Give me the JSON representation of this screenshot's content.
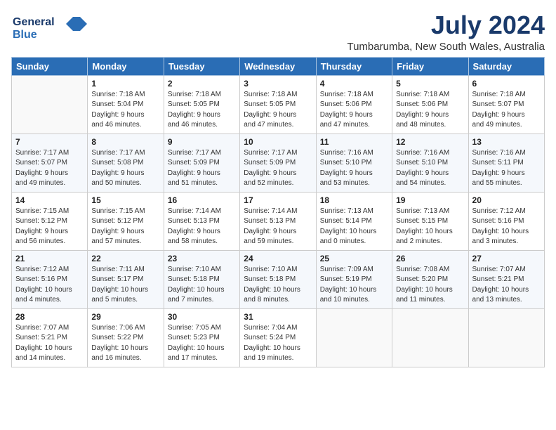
{
  "logo": {
    "line1": "General",
    "line2": "Blue"
  },
  "title": "July 2024",
  "location": "Tumbarumba, New South Wales, Australia",
  "days_of_week": [
    "Sunday",
    "Monday",
    "Tuesday",
    "Wednesday",
    "Thursday",
    "Friday",
    "Saturday"
  ],
  "weeks": [
    [
      {
        "day": "",
        "info": ""
      },
      {
        "day": "1",
        "info": "Sunrise: 7:18 AM\nSunset: 5:04 PM\nDaylight: 9 hours\nand 46 minutes."
      },
      {
        "day": "2",
        "info": "Sunrise: 7:18 AM\nSunset: 5:05 PM\nDaylight: 9 hours\nand 46 minutes."
      },
      {
        "day": "3",
        "info": "Sunrise: 7:18 AM\nSunset: 5:05 PM\nDaylight: 9 hours\nand 47 minutes."
      },
      {
        "day": "4",
        "info": "Sunrise: 7:18 AM\nSunset: 5:06 PM\nDaylight: 9 hours\nand 47 minutes."
      },
      {
        "day": "5",
        "info": "Sunrise: 7:18 AM\nSunset: 5:06 PM\nDaylight: 9 hours\nand 48 minutes."
      },
      {
        "day": "6",
        "info": "Sunrise: 7:18 AM\nSunset: 5:07 PM\nDaylight: 9 hours\nand 49 minutes."
      }
    ],
    [
      {
        "day": "7",
        "info": "Sunrise: 7:17 AM\nSunset: 5:07 PM\nDaylight: 9 hours\nand 49 minutes."
      },
      {
        "day": "8",
        "info": "Sunrise: 7:17 AM\nSunset: 5:08 PM\nDaylight: 9 hours\nand 50 minutes."
      },
      {
        "day": "9",
        "info": "Sunrise: 7:17 AM\nSunset: 5:09 PM\nDaylight: 9 hours\nand 51 minutes."
      },
      {
        "day": "10",
        "info": "Sunrise: 7:17 AM\nSunset: 5:09 PM\nDaylight: 9 hours\nand 52 minutes."
      },
      {
        "day": "11",
        "info": "Sunrise: 7:16 AM\nSunset: 5:10 PM\nDaylight: 9 hours\nand 53 minutes."
      },
      {
        "day": "12",
        "info": "Sunrise: 7:16 AM\nSunset: 5:10 PM\nDaylight: 9 hours\nand 54 minutes."
      },
      {
        "day": "13",
        "info": "Sunrise: 7:16 AM\nSunset: 5:11 PM\nDaylight: 9 hours\nand 55 minutes."
      }
    ],
    [
      {
        "day": "14",
        "info": "Sunrise: 7:15 AM\nSunset: 5:12 PM\nDaylight: 9 hours\nand 56 minutes."
      },
      {
        "day": "15",
        "info": "Sunrise: 7:15 AM\nSunset: 5:12 PM\nDaylight: 9 hours\nand 57 minutes."
      },
      {
        "day": "16",
        "info": "Sunrise: 7:14 AM\nSunset: 5:13 PM\nDaylight: 9 hours\nand 58 minutes."
      },
      {
        "day": "17",
        "info": "Sunrise: 7:14 AM\nSunset: 5:13 PM\nDaylight: 9 hours\nand 59 minutes."
      },
      {
        "day": "18",
        "info": "Sunrise: 7:13 AM\nSunset: 5:14 PM\nDaylight: 10 hours\nand 0 minutes."
      },
      {
        "day": "19",
        "info": "Sunrise: 7:13 AM\nSunset: 5:15 PM\nDaylight: 10 hours\nand 2 minutes."
      },
      {
        "day": "20",
        "info": "Sunrise: 7:12 AM\nSunset: 5:16 PM\nDaylight: 10 hours\nand 3 minutes."
      }
    ],
    [
      {
        "day": "21",
        "info": "Sunrise: 7:12 AM\nSunset: 5:16 PM\nDaylight: 10 hours\nand 4 minutes."
      },
      {
        "day": "22",
        "info": "Sunrise: 7:11 AM\nSunset: 5:17 PM\nDaylight: 10 hours\nand 5 minutes."
      },
      {
        "day": "23",
        "info": "Sunrise: 7:10 AM\nSunset: 5:18 PM\nDaylight: 10 hours\nand 7 minutes."
      },
      {
        "day": "24",
        "info": "Sunrise: 7:10 AM\nSunset: 5:18 PM\nDaylight: 10 hours\nand 8 minutes."
      },
      {
        "day": "25",
        "info": "Sunrise: 7:09 AM\nSunset: 5:19 PM\nDaylight: 10 hours\nand 10 minutes."
      },
      {
        "day": "26",
        "info": "Sunrise: 7:08 AM\nSunset: 5:20 PM\nDaylight: 10 hours\nand 11 minutes."
      },
      {
        "day": "27",
        "info": "Sunrise: 7:07 AM\nSunset: 5:21 PM\nDaylight: 10 hours\nand 13 minutes."
      }
    ],
    [
      {
        "day": "28",
        "info": "Sunrise: 7:07 AM\nSunset: 5:21 PM\nDaylight: 10 hours\nand 14 minutes."
      },
      {
        "day": "29",
        "info": "Sunrise: 7:06 AM\nSunset: 5:22 PM\nDaylight: 10 hours\nand 16 minutes."
      },
      {
        "day": "30",
        "info": "Sunrise: 7:05 AM\nSunset: 5:23 PM\nDaylight: 10 hours\nand 17 minutes."
      },
      {
        "day": "31",
        "info": "Sunrise: 7:04 AM\nSunset: 5:24 PM\nDaylight: 10 hours\nand 19 minutes."
      },
      {
        "day": "",
        "info": ""
      },
      {
        "day": "",
        "info": ""
      },
      {
        "day": "",
        "info": ""
      }
    ]
  ]
}
